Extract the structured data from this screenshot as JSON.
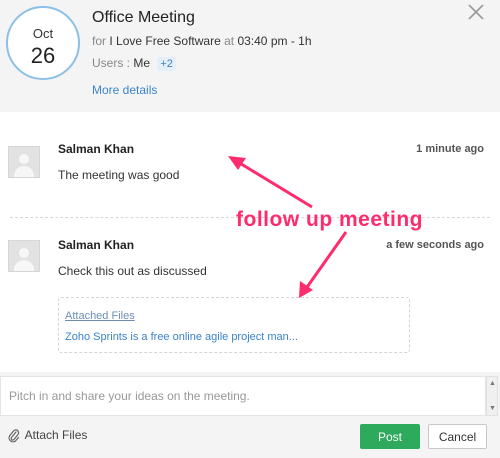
{
  "event": {
    "month": "Oct",
    "day": "26",
    "title": "Office Meeting",
    "for_prefix": "for",
    "project": "I Love Free Software",
    "at_word": "at",
    "time": "03:40 pm - 1h",
    "users_label": "Users :",
    "users_me": "Me",
    "users_more": "+2",
    "more_details": "More details"
  },
  "comments": [
    {
      "author": "Salman Khan",
      "time": "1 minute ago",
      "text": "The meeting was good"
    },
    {
      "author": "Salman Khan",
      "time": "a few seconds ago",
      "text": "Check this out as discussed"
    }
  ],
  "attachment": {
    "title": "Attached Files",
    "file": "Zoho Sprints is a free online agile project man..."
  },
  "annotation": {
    "text": "follow up meeting",
    "color": "#ff2c6d"
  },
  "composer": {
    "placeholder": "Pitch in and share your ideas on the meeting.",
    "attach_label": "Attach Files",
    "post_label": "Post",
    "cancel_label": "Cancel"
  },
  "icons": {
    "close": "close-icon",
    "attach": "paperclip-icon",
    "avatar": "avatar-placeholder"
  },
  "colors": {
    "accent": "#3a83c9",
    "post": "#2eaa5c",
    "date_ring": "#8cc0e6"
  }
}
